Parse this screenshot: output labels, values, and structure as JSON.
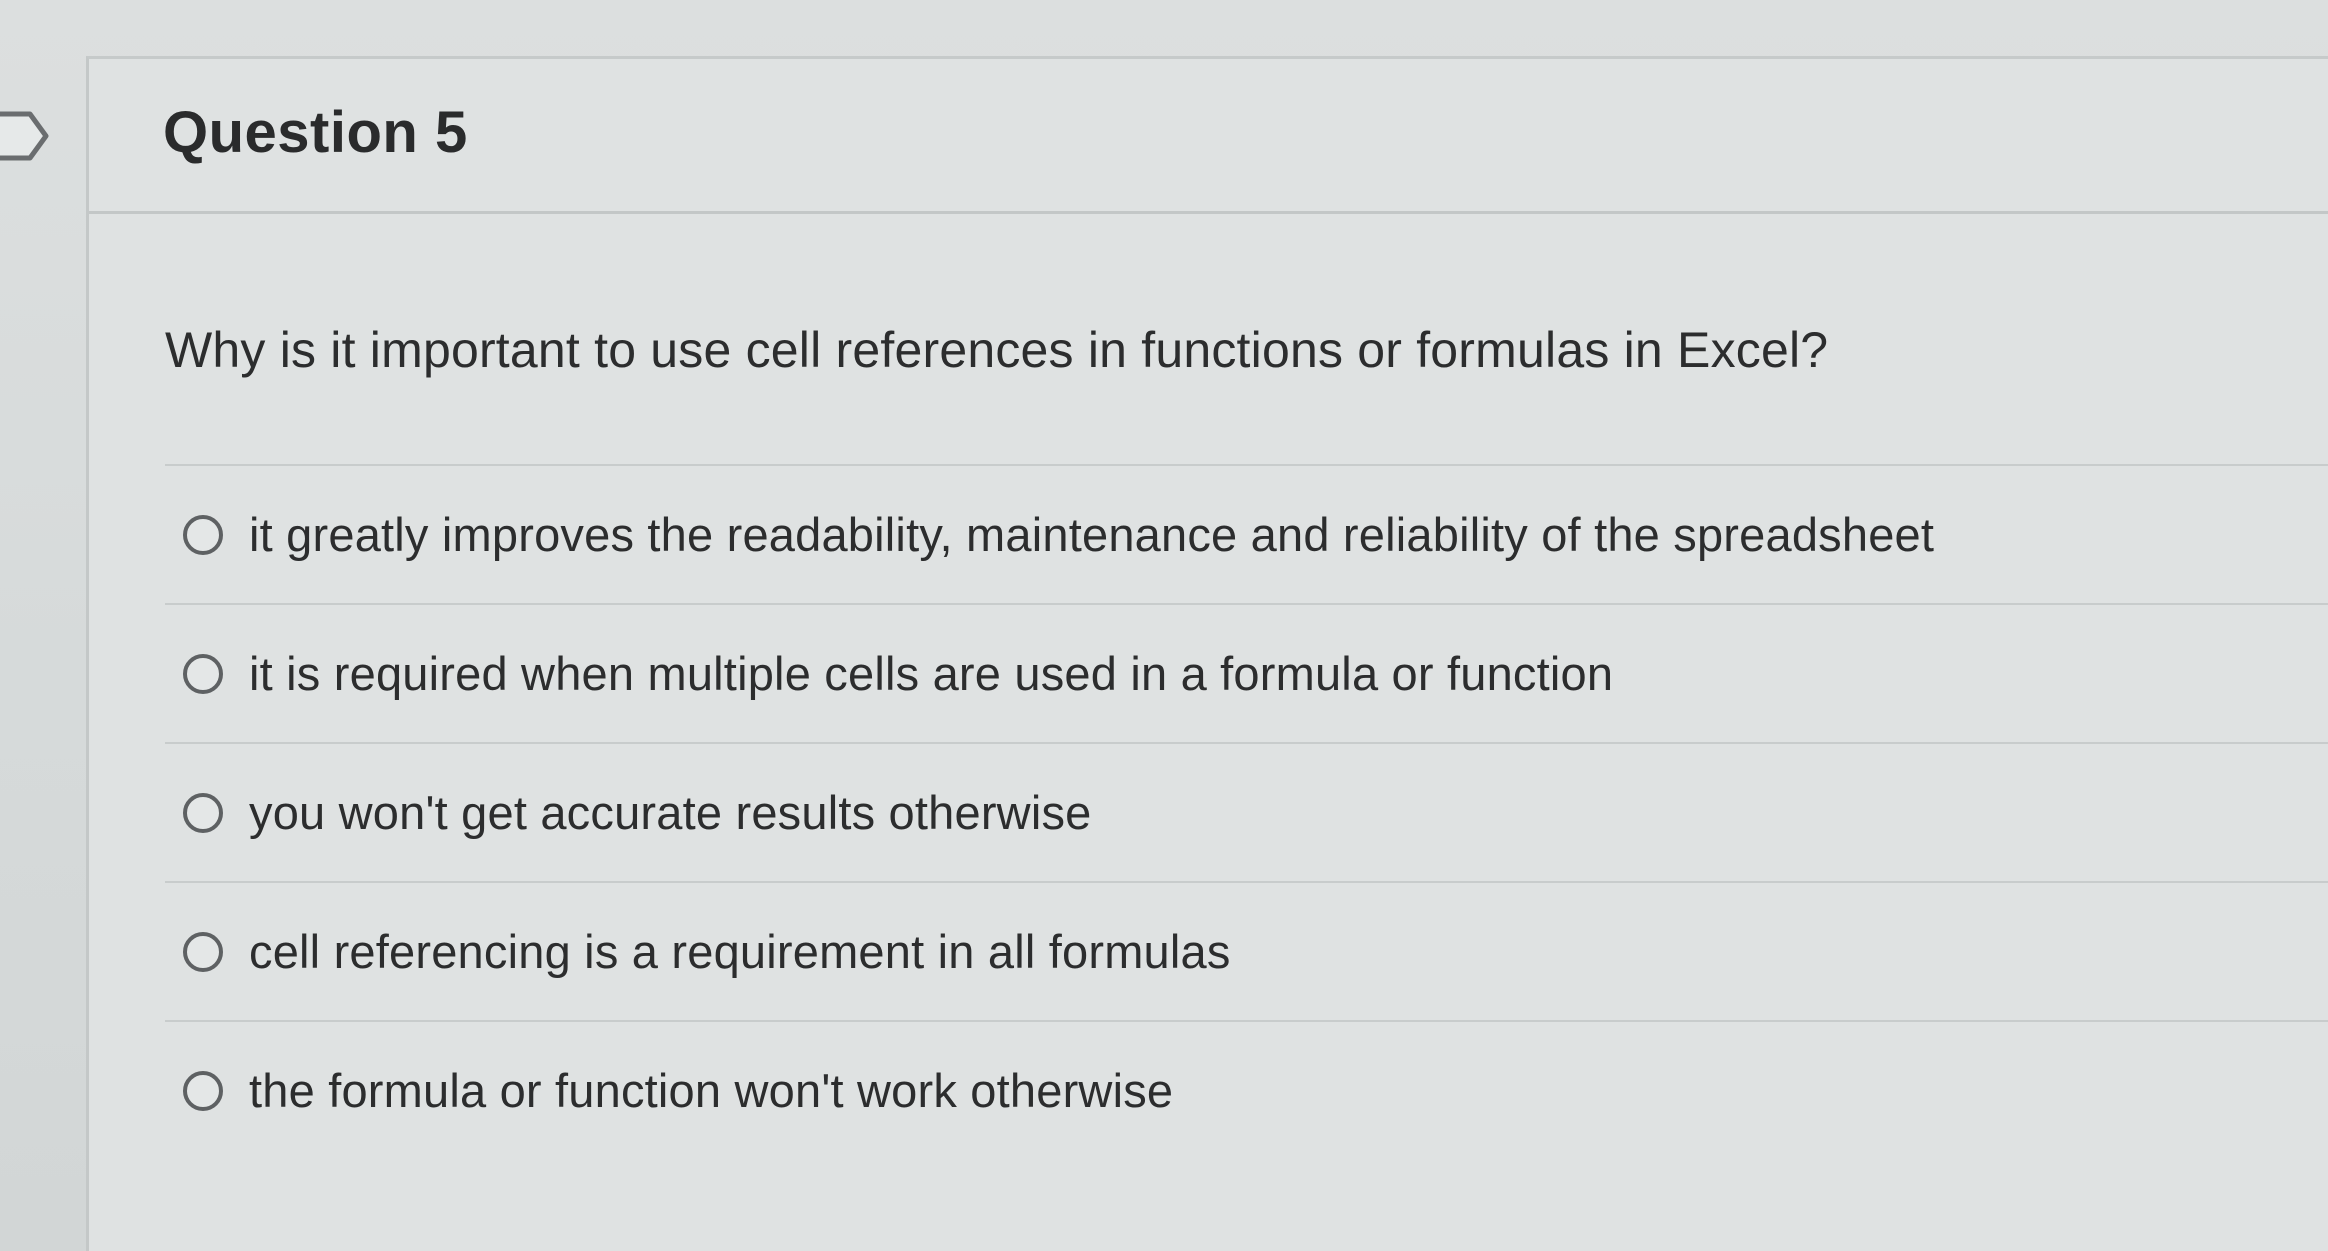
{
  "question": {
    "title": "Question 5",
    "prompt": "Why is it important to use cell references in functions or formulas in Excel?",
    "options": [
      {
        "label": "it greatly improves the readability, maintenance and reliability of the spreadsheet",
        "selected": false
      },
      {
        "label": "it is required when multiple cells are used in a formula or function",
        "selected": false
      },
      {
        "label": "you won't get accurate results otherwise",
        "selected": false
      },
      {
        "label": "cell referencing is a requirement in all formulas",
        "selected": false
      },
      {
        "label": "the formula or function won't work otherwise",
        "selected": false
      }
    ]
  },
  "icons": {
    "flag": "question-flag-icon",
    "radio": "radio-button-icon"
  },
  "colors": {
    "background": "#d9dcdc",
    "text": "#2c2d2e",
    "divider": "#c8cccc",
    "radio_border": "#5e6163"
  }
}
